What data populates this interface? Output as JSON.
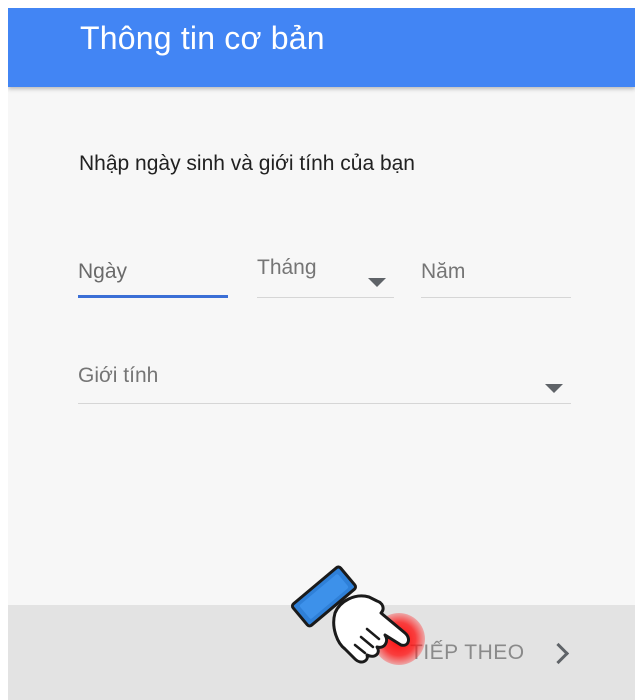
{
  "header": {
    "title": "Thông tin cơ bản"
  },
  "form": {
    "prompt": "Nhập ngày sinh và giới tính của bạn",
    "day": {
      "placeholder": "Ngày"
    },
    "month": {
      "placeholder": "Tháng"
    },
    "year": {
      "placeholder": "Năm"
    },
    "gender": {
      "placeholder": "Giới tính"
    }
  },
  "footer": {
    "next_label": "TIẾP THEO"
  },
  "colors": {
    "header_bg": "#4285f4",
    "active_underline": "#3b6fd6",
    "footer_bg": "#e3e3e3",
    "tap_indicator": "#ff0000"
  },
  "icons": {
    "month_dropdown": "arrow-drop-down-icon",
    "gender_dropdown": "arrow-drop-down-icon",
    "next": "chevron-right-icon",
    "pointer": "hand-pointer-icon"
  }
}
